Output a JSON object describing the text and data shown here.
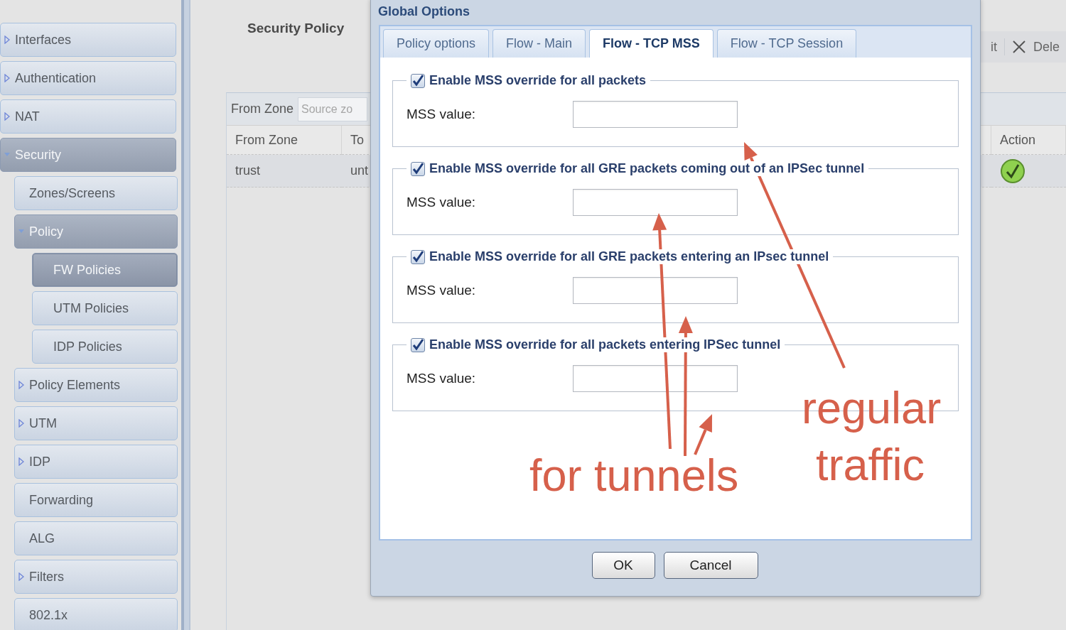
{
  "sidebar": {
    "items": [
      {
        "label": "Interfaces",
        "expanded": false,
        "selected": false
      },
      {
        "label": "Authentication",
        "expanded": false,
        "selected": false
      },
      {
        "label": "NAT",
        "expanded": false,
        "selected": false
      },
      {
        "label": "Security",
        "expanded": true,
        "selected": false,
        "children": [
          {
            "label": "Zones/Screens",
            "selected": false
          },
          {
            "label": "Policy",
            "expanded": true,
            "selected": false,
            "children": [
              {
                "label": "FW Policies",
                "selected": true
              },
              {
                "label": "UTM Policies",
                "selected": false
              },
              {
                "label": "IDP Policies",
                "selected": false
              }
            ]
          },
          {
            "label": "Policy Elements",
            "expanded": false,
            "selected": false
          },
          {
            "label": "UTM",
            "expanded": false,
            "selected": false
          },
          {
            "label": "IDP",
            "expanded": false,
            "selected": false
          },
          {
            "label": "Forwarding",
            "selected": false
          },
          {
            "label": "ALG",
            "selected": false
          },
          {
            "label": "Filters",
            "expanded": false,
            "selected": false
          },
          {
            "label": "802.1x",
            "selected": false
          }
        ]
      }
    ]
  },
  "main": {
    "title": "Security Policy",
    "toolbar": [
      {
        "kind": "edit",
        "label": "it"
      },
      {
        "kind": "delete",
        "label": "Dele"
      }
    ],
    "filter": {
      "label": "From Zone",
      "placeholder": "Source zo"
    },
    "table": {
      "columns": [
        "From Zone",
        "To",
        "Action"
      ],
      "rows": [
        {
          "cells": [
            "trust",
            "unt"
          ]
        }
      ]
    }
  },
  "dialog": {
    "title": "Global Options",
    "tabs": [
      {
        "label": "Policy options",
        "selected": false
      },
      {
        "label": "Flow - Main",
        "selected": false
      },
      {
        "label": "Flow - TCP MSS",
        "selected": true
      },
      {
        "label": "Flow - TCP Session",
        "selected": false
      }
    ],
    "sections": [
      {
        "label": "Enable MSS override for all packets",
        "checked": true,
        "field_label": "MSS value:"
      },
      {
        "label": "Enable MSS override for all GRE packets coming out of an IPSec tunnel",
        "checked": true,
        "field_label": "MSS value:"
      },
      {
        "label": "Enable MSS override for all GRE packets entering an IPsec tunnel",
        "checked": true,
        "field_label": "MSS value:"
      },
      {
        "label": "Enable MSS override for all packets entering IPSec tunnel",
        "checked": true,
        "field_label": "MSS value:"
      }
    ],
    "buttons": [
      "OK",
      "Cancel"
    ]
  },
  "annotations": {
    "labels": [
      "regular",
      "traffic",
      "for tunnels"
    ]
  }
}
